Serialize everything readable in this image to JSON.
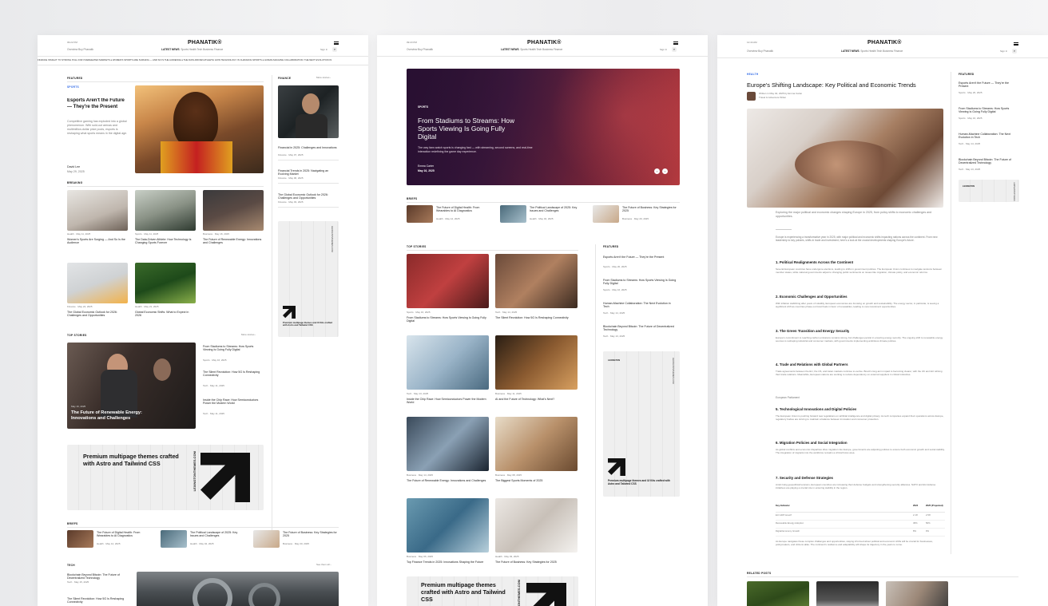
{
  "colors": {
    "accent": "#2b66e6",
    "hero_overlay": "#3a1a4a",
    "text": "#111111"
  },
  "shared": {
    "logo": "PHANATIK®",
    "nav_left": "Overview  Buy Phanatik",
    "nav": "LATEST NEWS",
    "nav_links": "Sports  Health  Tech  Business  Finance",
    "signin": "Sign In",
    "menu_icon": "hamburger-icon",
    "search_icon": "search-icon"
  },
  "p1": {
    "time": "09:22 PM",
    "ticker": "FINANCE INSIGHT: TO STRONG PULL FOR OVERHEATED MARKETS ●  WOMEN'S SPORTS ARE SURGING — AND SO IS THE AUDIENCE ●  THE DATA-DRIVEN ATHLETE: HOW TECHNOLOGY IS CHANGING SPORTS ●  HUMAN-MACHINE COLLABORATION: THE NEXT EVOLUTION IN",
    "featured": "FEATURED",
    "sports": "SPORTS",
    "feat_title": "Esports Aren't the Future — They're the Present",
    "feat_desc": "Competitive gaming has exploded into a global phenomenon. With sold-out arenas and multimillion-dollar prize pools, esports is reshaping what sports means in the digital age.",
    "feat_author": "David Lee",
    "feat_date": "May 29, 2025",
    "finance": "FINANCE",
    "more_stories": "More stories  ›",
    "fin_items": [
      {
        "title": "Financial in 2025: Challenges and Innovations",
        "meta": "Finance  ·  May 07, 2025"
      },
      {
        "title": "Financial Trends in 2025: Navigating an Evolving Market",
        "meta": "Finance  ·  May 06, 2025"
      },
      {
        "title": "The Global Economic Outlook for 2026: Challenges and Opportunities",
        "meta": "Finance  ·  May 03, 2025"
      }
    ],
    "breaking": "BREAKING",
    "break_items": [
      {
        "meta": "Health  ·  May 11, 2025",
        "title": "Women's Sports Are Surging — And So Is the Audience"
      },
      {
        "meta": "Sports  ·  May 11, 2025",
        "title": "The Data-Driven Athlete: How Technology Is Changing Sports Forever"
      },
      {
        "meta": "Business  ·  May 16, 2025",
        "title": "The Future of Renewable Energy: Innovations and Challenges"
      },
      {
        "meta": "Finance  ·  May 24, 2025",
        "title": "The Global Economic Outlook for 2026: Challenges and Opportunities"
      },
      {
        "meta": "Health  ·  May 21, 2025",
        "title": "Global Economic Shifts: What to Expect in 2026"
      }
    ],
    "ad_small": "Premium multipage themes and UI Kits crafted with Astro and Tailwind CSS",
    "ad_vert": "LEXINGTONTHEMES.COM",
    "top_stories": "TOP STORIES",
    "top_big_date": "May 16, 2025",
    "top_big_title": "The Future of Renewable Energy: Innovations and Challenges",
    "top_list": [
      {
        "title": "From Stadiums to Streams: How Sports Viewing Is Going Fully Digital",
        "meta": "Sports  ·  May 16, 2025"
      },
      {
        "title": "The Silent Revolution: How 5G Is Reshaping Connectivity",
        "meta": "Tech  ·  May 11, 2025"
      },
      {
        "title": "Inside the Chip Race: How Semiconductors Power the Modern World",
        "meta": "Tech  ·  May 11, 2025"
      }
    ],
    "ad_big": "Premium multipage themes crafted with Astro and Tailwind CSS",
    "briefs": "BRIEFS",
    "brief_items": [
      {
        "title": "The Future of Digital Health: From Wearables to AI Diagnostics",
        "meta": "Health  ·  May 12, 2025"
      },
      {
        "title": "The Political Landscape of 2025: Key Issues and Challenges",
        "meta": "Health  ·  May 04, 2025"
      },
      {
        "title": "The Future of Business: Key Strategies for 2025",
        "meta": "Business  ·  May 20, 2025"
      }
    ],
    "tech": "TECH",
    "see_more": "See them all  ›",
    "tech_items": [
      {
        "title": "Blockchain Beyond Bitcoin: The Future of Decentralized Technology",
        "meta": "Tech  ·  May 15, 2025"
      },
      {
        "title": "The Silent Revolution: How 5G Is Reshaping Connectivity",
        "meta": ""
      }
    ]
  },
  "p2": {
    "time": "09:23 PM",
    "hero_cat": "SPORTS",
    "hero_title": "From Stadiums to Streams: How Sports Viewing Is Going Fully Digital",
    "hero_desc": "The way fans watch sports is changing fast — with streaming, second screens, and real-time interaction redefining the game day experience.",
    "hero_author": "Emma Carter",
    "hero_date": "May 16, 2025",
    "briefs": "BRIEFS",
    "brief_items": [
      {
        "title": "The Future of Digital Health: From Wearables to AI Diagnostics",
        "meta": "Health  ·  May 12, 2025"
      },
      {
        "title": "The Political Landscape of 2025: Key Issues and Challenges",
        "meta": "Health  ·  May 04, 2025"
      },
      {
        "title": "The Future of Business: Key Strategies for 2025",
        "meta": "Business  ·  May 20, 2025"
      }
    ],
    "top_stories": "TOP STORIES",
    "featured": "FEATURED",
    "grid": [
      {
        "meta": "Sports  ·  May 16, 2025",
        "title": "From Stadiums to Streams: How Sports Viewing Is Going Fully Digital"
      },
      {
        "meta": "Tech  ·  May 14, 2025",
        "title": "The Silent Revolution: How 5G Is Reshaping Connectivity"
      },
      {
        "meta": "Tech  ·  May 13, 2025",
        "title": "Inside the Chip Race: How Semiconductors Power the Modern World"
      },
      {
        "meta": "Business  ·  May 11, 2025",
        "title": "AI and the Future of Technology: What's Next?"
      },
      {
        "meta": "Business  ·  May 14, 2025",
        "title": "The Future of Renewable Energy: Innovations and Challenges"
      },
      {
        "meta": "Business  ·  May 08, 2025",
        "title": "The Biggest Sports Moments of 2025"
      },
      {
        "meta": "Business  ·  May 06, 2025",
        "title": "Top Finance Trends in 2025: Innovations Shaping the Future"
      },
      {
        "meta": "Health  ·  May 03, 2025",
        "title": "The Future of Business: Key Strategies for 2025"
      }
    ],
    "feat_list": [
      {
        "title": "Esports Aren't the Future — They're the Present",
        "meta": "Sports  ·  May 20, 2025"
      },
      {
        "title": "From Stadiums to Streams: How Sports Viewing Is Going Fully Digital",
        "meta": "Sports  ·  May 16, 2025"
      },
      {
        "title": "Human-Machine Collaboration: The Next Evolution in Tech",
        "meta": "Tech  ·  May 14, 2025"
      },
      {
        "title": "Blockchain Beyond Bitcoin: The Future of Decentralized Technology",
        "meta": "Tech  ·  May 13, 2025"
      }
    ],
    "ad_small": "Premium multipage themes and UI Kits crafted with Astro and Tailwind CSS",
    "ad_big": "Premium multipage themes crafted with Astro and Tailwind CSS",
    "ad_vert": "LEXINGTONTHEMES.COM"
  },
  "p3": {
    "time": "12:44 AM",
    "cat": "HEALTH",
    "title": "Europe's Shifting Landscape: Key Political and Economic Trends",
    "byline": "Written in May 02, 2025 by Emma Carter",
    "byline2": "Travel & Adventure Writer",
    "lede": "Exploring the major political and economic changes shaping Europe in 2025, from policy shifts to economic challenges and opportunities.",
    "intro": "Europe is experiencing a transformative year in 2025, with major political and economic shifts impacting nations across the continent. From new leadership to key policies, shifts in trade and investment, here's a look at the crucial developments shaping Europe's future.",
    "sections": [
      {
        "h": "1. Political Realignments Across the Continent",
        "p": "Several European countries have undergone elections, leading to shifts in government policies. The European Union continues to navigate tensions between member states, while national governments adjust to changing public sentiments on issues like migration, climate policy, and economic reforms."
      },
      {
        "h": "2. Economic Challenges and Opportunities",
        "p": "With inflation stabilizing after years of volatility, European economies are focusing on growth and sustainability. The energy sector, in particular, is seeing a significant shift as countries phase out fossil fuels in favor of renewables, leading to new investment opportunities."
      },
      {
        "h": "3. The Green Transition and Energy Security",
        "p": "Europe's commitment to reaching carbon emissions remains strong, but challenges persist in ensuring energy security. The ongoing shift to renewable energy sources is reshaping industrial and consumer markets, with governments implementing ambitious climate policies."
      },
      {
        "h": "4. Trade and Relations with Global Partners",
        "p": "Trade agreements between the EU, the US, and Asian markets continue to evolve. Brexit's long-term impact is becoming clearer, with the UK and EU refining their trade relations. Meanwhile, European nations are working to reduce dependency on external suppliers in critical industries."
      },
      {
        "h": "5. Technological Innovations and Digital Policies",
        "p": "The European Union is pushing forward new regulations on artificial intelligence and digital privacy. As tech companies expand their operations across Europe, regulatory bodies are striving to maintain a balance between innovation and consumer protection."
      },
      {
        "h": "6. Migration Policies and Social Integration",
        "p": "As global conflicts and economic disparities drive migration into Europe, governments are adjusting policies to ensure both economic growth and social stability. The integration of migrants into the workforce remains a critical focus area."
      },
      {
        "h": "7. Security and Defense Strategies",
        "p": "Amid rising geopolitical tensions, European countries are increasing their defense budgets and strengthening security alliances. NATO and EU defense initiatives are playing a crucial role in ensuring stability in the region."
      }
    ],
    "european_parliament": "European Parliament",
    "table": {
      "headers": [
        "Key Indicator",
        "2024",
        "2025 (Projected)"
      ],
      "rows": [
        [
          "EU GDP Growth",
          "2.1%",
          "2.5%"
        ],
        [
          "Renewable Energy Adoption",
          "45%",
          "50%"
        ],
        [
          "Digital Economy Growth",
          "8%",
          "9%"
        ]
      ]
    },
    "outro": "As Europe navigates these complex challenges and opportunities, staying informed about political and economic shifts will be crucial for businesses, policymakers, and citizens alike. The continent's resilience and adaptability will shape its trajectory in the years to come.",
    "featured": "FEATURED",
    "feat_list": [
      {
        "title": "Esports Aren't the Future — They're the Present",
        "meta": "Sports  ·  May 20, 2025"
      },
      {
        "title": "From Stadiums to Streams: How Sports Viewing Is Going Fully Digital",
        "meta": "Sports  ·  May 16, 2025"
      },
      {
        "title": "Human-Machine Collaboration: The Next Evolution in Tech",
        "meta": "Tech  ·  May 14, 2025"
      },
      {
        "title": "Blockchain Beyond Bitcoin: The Future of Decentralized Technology",
        "meta": "Tech  ·  May 13, 2025"
      }
    ],
    "ad_vert": "LEXINGTONTHEMES.COM",
    "ad_label": "LEXINGTON",
    "related": "RELATED POSTS"
  }
}
